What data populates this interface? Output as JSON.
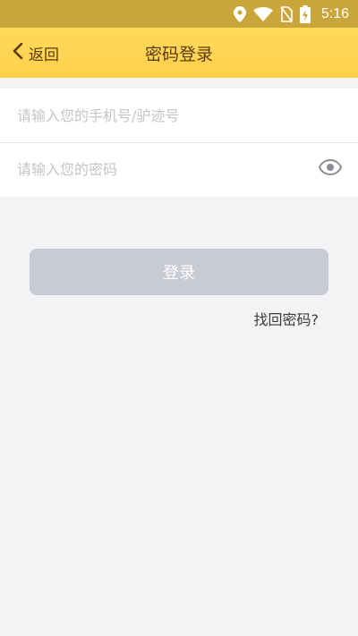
{
  "status_bar": {
    "time": "5:16",
    "icons": [
      "location-icon",
      "wifi-icon",
      "no-sim-icon",
      "battery-charging-icon"
    ]
  },
  "nav": {
    "back_label": "返回",
    "title": "密码登录"
  },
  "form": {
    "account_placeholder": "请输入您的手机号/驴迹号",
    "account_value": "",
    "password_placeholder": "请输入您的密码",
    "password_value": ""
  },
  "actions": {
    "login_label": "登录",
    "forgot_label": "找回密码?"
  },
  "colors": {
    "nav_background": "#ffd458",
    "status_background": "#c9a53a",
    "title_text": "#5a3b10",
    "button_disabled": "#c8cad5",
    "page_background": "#f2f3f5"
  }
}
